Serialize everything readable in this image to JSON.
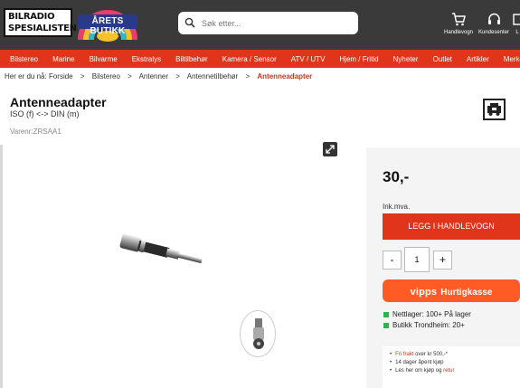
{
  "header": {
    "logo_line1": "BILRADIO",
    "logo_line2": "SPESIALISTEN AS",
    "badge_text": "ÅRETS BUTIKK",
    "search_placeholder": "Søk etter...",
    "cart_label": "Handlevogn",
    "service_label": "Kundesenter",
    "login_label": "L"
  },
  "nav": {
    "items": [
      "Bilstereo",
      "Marine",
      "Bilvarme",
      "Ekstralys",
      "Biltilbehør",
      "Kamera / Sensor",
      "ATV / UTV",
      "Hjem / Fritid",
      "Nyheter",
      "Outlet",
      "Artikler",
      "Merker"
    ]
  },
  "breadcrumb": {
    "prefix": "Her er du nå:",
    "items": [
      "Forside",
      "Bilstereo",
      "Antenner",
      "Antennetilbehør"
    ],
    "separator": ">",
    "current": "Antenneadapter"
  },
  "product": {
    "title": "Antenneadapter",
    "subtitle": "ISO (f) <-> DIN (m)",
    "sku": "Varenr:ZRSAA1",
    "price": "30,-",
    "vat_note": "Ink.mva.",
    "add_to_cart": "LEGG I HANDLEVOGN",
    "qty_minus": "-",
    "qty_value": "1",
    "qty_plus": "+",
    "vipps_logo": "vipps",
    "vipps_label": "Hurtigkasse",
    "stock_online": "Nettlager: 100+ På lager",
    "stock_store": "Butikk Trondheim: 20+",
    "info": {
      "shipping_prefix": "Fri frakt",
      "shipping_rest": " over kr 500,-*",
      "return_policy": "14 dager åpent kjøp",
      "read_more_prefix": "Les her om kjøp og ",
      "read_more_link": "retur"
    }
  },
  "colors": {
    "header_bg": "#3a3a3a",
    "nav_bg": "#e0341b",
    "accent": "#c8381c",
    "vipps": "#ff5b24",
    "stock_green": "#2fb34a"
  }
}
